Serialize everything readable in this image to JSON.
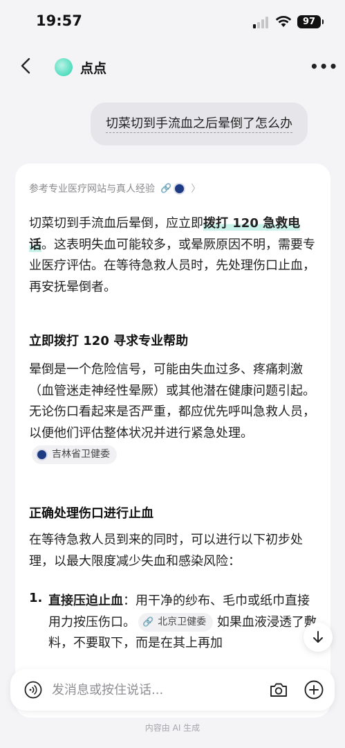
{
  "status_bar": {
    "time": "19:57",
    "battery": "97"
  },
  "header": {
    "title": "点点"
  },
  "user_message": "切菜切到手流血之后晕倒了怎么办",
  "answer": {
    "reference_text": "参考专业医疗网站与真人经验",
    "intro_pre": "切菜切到手流血后晕倒，应立即",
    "intro_highlight": "拨打 120 急救电话",
    "intro_post": "。这表明失血可能较多，或晕厥原因不明，需要专业医疗评估。在等待急救人员时，先处理伤口止血，再安抚晕倒者。",
    "section1_heading": "立即拨打 120 寻求专业帮助",
    "section1_body": "晕倒是一个危险信号，可能由失血过多、疼痛刺激（血管迷走神经性晕厥）或其他潜在健康问题引起。 无论伤口看起来是否严重，都应优先呼叫急救人员，以便他们评估整体状况并进行紧急处理。",
    "section1_source": "吉林省卫健委",
    "section2_heading": "正确处理伤口进行止血",
    "section2_body": "在等待急救人员到来的同时，可以进行以下初步处理，以最大限度减少失血和感染风险：",
    "list": [
      {
        "number": "1.",
        "title": "直接压迫止血",
        "text_a": "：用干净的纱布、毛巾或纸巾直接用力按压伤口。",
        "source": "北京卫健委",
        "text_b": "如果血液浸透了敷料，不要取下，而是在其上再加"
      }
    ]
  },
  "input": {
    "placeholder": "发消息或按住说话..."
  },
  "disclaimer": "内容由 AI 生成",
  "colors": {
    "accent": "#5fe0c4",
    "highlight": "#c9f2ea",
    "emblem": "#1d3b82"
  }
}
